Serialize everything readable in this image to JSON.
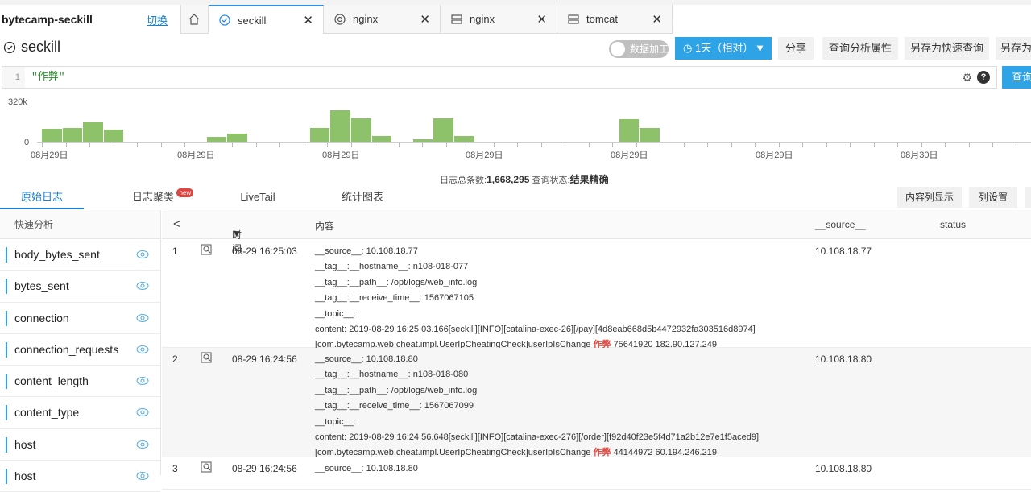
{
  "project": {
    "name": "bytecamp-seckill",
    "switch_label": "切换"
  },
  "tabs": [
    {
      "label": "seckill",
      "icon": "query-icon",
      "close": "✕"
    },
    {
      "label": "nginx",
      "icon": "target-icon",
      "close": "✕"
    },
    {
      "label": "nginx",
      "icon": "server-icon",
      "close": "✕"
    },
    {
      "label": "tomcat",
      "icon": "server-icon",
      "close": "✕"
    }
  ],
  "title": "seckill",
  "toolbar": {
    "toggle_label": "数据加工",
    "time_range": "1天（相对）",
    "share": "分享",
    "query_props": "查询分析属性",
    "save_quick": "另存为快速查询",
    "save_as": "另存为"
  },
  "query": {
    "line": "1",
    "text": "\"作弊\"",
    "search": "查询"
  },
  "histogram": {
    "y_max_label": "320k",
    "y_min_label": "0",
    "x_labels": [
      "08月29日",
      "08月29日",
      "08月29日",
      "08月29日",
      "08月29日",
      "08月29日",
      "08月30日"
    ],
    "bars": [
      0.34,
      0.38,
      0.52,
      0.32,
      0,
      0,
      0,
      0,
      0.12,
      0.22,
      0,
      0,
      0,
      0.36,
      0.84,
      0.64,
      0.16,
      0,
      0.06,
      0.62,
      0.16,
      0,
      0,
      0,
      0,
      0,
      0,
      0,
      0.6,
      0.38
    ],
    "summary_prefix": "日志总条数:",
    "summary_count": "1,668,295",
    "summary_status_prefix": "查询状态:",
    "summary_status": "结果精确"
  },
  "subtabs": {
    "raw": "原始日志",
    "cluster": "日志聚类",
    "cluster_badge": "new",
    "livetail": "LiveTail",
    "stats": "统计图表",
    "content_display": "内容列显示",
    "col_settings": "列设置"
  },
  "left_panel": {
    "header": "快速分析",
    "fields": [
      "body_bytes_sent",
      "bytes_sent",
      "connection",
      "connection_requests",
      "content_length",
      "content_type",
      "host",
      "host"
    ]
  },
  "table": {
    "header": {
      "time": "时间",
      "content": "内容",
      "source": "__source__",
      "status": "status",
      "prev": "<"
    },
    "rows": [
      {
        "num": "1",
        "time": "08-29 16:25:03",
        "source": "10.108.18.77",
        "lines": [
          "__source__: 10.108.18.77",
          "__tag__:__hostname__: n108-018-077",
          "__tag__:__path__: /opt/logs/web_info.log",
          "__tag__:__receive_time__: 1567067105",
          "__topic__:",
          "content: 2019-08-29 16:25:03.166[seckill][INFO][catalina-exec-26][/pay][4d8eab668d5b4472932fa303516d8974]"
        ],
        "last_pre": "[com.bytecamp.web.cheat.impl.UserIpCheatingCheck]userIpIsChange ",
        "last_hl": "作弊",
        "last_post": " 75641920 182.90.127.249"
      },
      {
        "num": "2",
        "time": "08-29 16:24:56",
        "source": "10.108.18.80",
        "lines": [
          "__source__: 10.108.18.80",
          "__tag__:__hostname__: n108-018-080",
          "__tag__:__path__: /opt/logs/web_info.log",
          "__tag__:__receive_time__: 1567067099",
          "__topic__:",
          "content: 2019-08-29 16:24:56.648[seckill][INFO][catalina-exec-276][/order][f92d40f23e5f4d71a2b12e7e1f5aced9]"
        ],
        "last_pre": "[com.bytecamp.web.cheat.impl.UserIpCheatingCheck]userIpIsChange ",
        "last_hl": "作弊",
        "last_post": " 44144972 60.194.246.219"
      },
      {
        "num": "3",
        "time": "08-29 16:24:56",
        "source": "10.108.18.80",
        "lines": [
          "__source__: 10.108.18.80"
        ]
      }
    ]
  }
}
